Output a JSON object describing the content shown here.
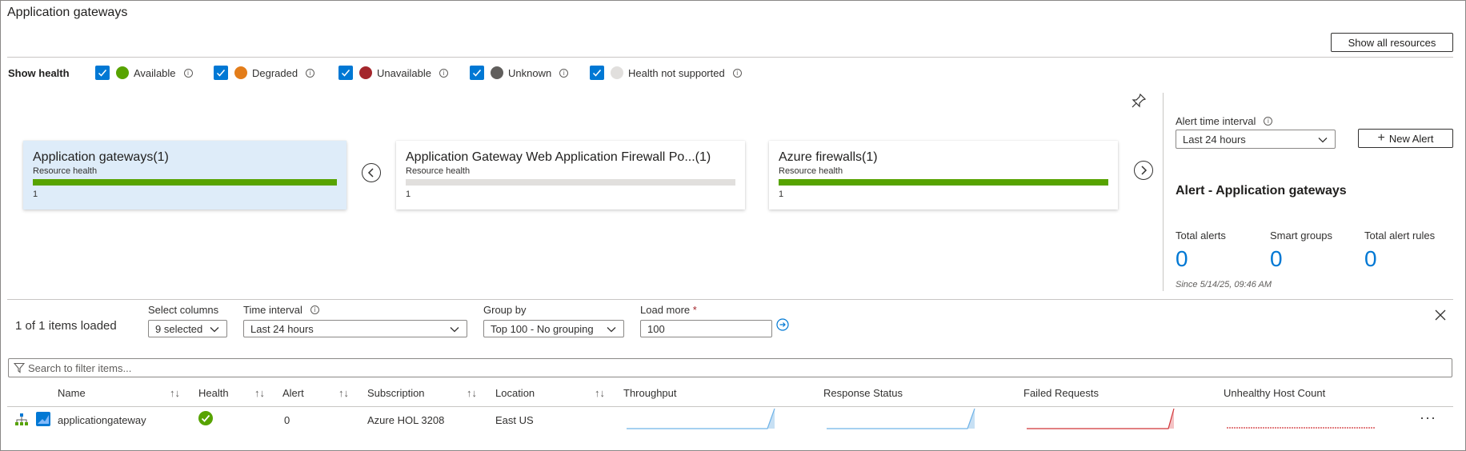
{
  "page": {
    "title": "Application gateways"
  },
  "toolbar": {
    "show_all_resources": "Show all resources"
  },
  "health": {
    "label": "Show health",
    "items": [
      {
        "label": "Available",
        "color": "#57a300"
      },
      {
        "label": "Degraded",
        "color": "#e37d1a"
      },
      {
        "label": "Unavailable",
        "color": "#a4262c"
      },
      {
        "label": "Unknown",
        "color": "#605e5c"
      },
      {
        "label": "Health not supported",
        "color": "#e1dfdd"
      }
    ]
  },
  "tiles": [
    {
      "title": "Application gateways(1)",
      "subtitle": "Resource health",
      "count": "1",
      "bar_color": "#57a300",
      "selected": true
    },
    {
      "title": "Application Gateway Web Application Firewall Po...(1)",
      "subtitle": "Resource health",
      "count": "1",
      "bar_color": "#e1dfdd",
      "selected": false
    },
    {
      "title": "Azure firewalls(1)",
      "subtitle": "Resource health",
      "count": "1",
      "bar_color": "#57a300",
      "selected": false
    }
  ],
  "alerts": {
    "interval_label": "Alert time interval",
    "interval_value": "Last 24 hours",
    "new_alert": "New Alert",
    "section_title": "Alert - Application gateways",
    "total_alerts_label": "Total alerts",
    "total_alerts": "0",
    "smart_groups_label": "Smart groups",
    "smart_groups": "0",
    "total_rules_label": "Total alert rules",
    "total_rules": "0",
    "since": "Since 5/14/25, 09:46 AM"
  },
  "filters": {
    "items_loaded": "1 of 1 items loaded",
    "select_columns_label": "Select columns",
    "select_columns_value": "9 selected",
    "time_interval_label": "Time interval",
    "time_interval_value": "Last 24 hours",
    "group_by_label": "Group by",
    "group_by_value": "Top 100 - No grouping",
    "load_more_label": "Load more",
    "load_more_required": "*",
    "load_more_value": "100",
    "search_placeholder": "Search to filter items..."
  },
  "table": {
    "columns": [
      "Name",
      "Health",
      "Alert",
      "Subscription",
      "Location",
      "Throughput",
      "Response Status",
      "Failed Requests",
      "Unhealthy Host Count"
    ],
    "rows": [
      {
        "name": "applicationgateway",
        "alert": "0",
        "subscription": "Azure HOL 3208",
        "location": "East US"
      }
    ]
  },
  "colors": {
    "accent": "#0078d4",
    "selected_tile": "#deecf9",
    "sparkline_blue": "#6fb3e8",
    "sparkline_red": "#d13438"
  },
  "icons": [
    "info-icon",
    "pin-icon",
    "chevron-left-icon",
    "chevron-right-icon",
    "plus-icon",
    "chevron-down-icon",
    "arrow-right-circle-icon",
    "close-icon",
    "filter-icon",
    "sort-icon",
    "hierarchy-icon",
    "app-gateway-icon",
    "check-circle-icon",
    "more-icon"
  ]
}
